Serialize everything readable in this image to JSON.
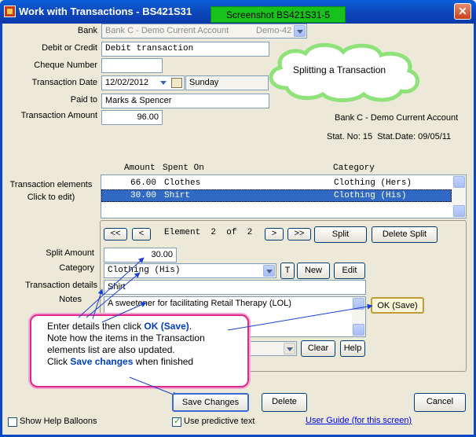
{
  "window": {
    "title": "Work with Transactions - BS421S31",
    "close_glyph": "✕"
  },
  "banner": "Screenshot BS421S31-5",
  "cloud_note": "Splitting a Transaction",
  "form": {
    "bank_label": "Bank",
    "bank_value": "Bank C - Demo Current Account",
    "bank_code": "Demo-42",
    "debit_label": "Debit or Credit",
    "debit_value": "Debit transaction",
    "cheque_label": "Cheque Number",
    "cheque_value": "",
    "date_label": "Transaction Date",
    "date_value": "12/02/2012",
    "day_value": "Sunday",
    "paid_label": "Paid to",
    "paid_value": "Marks & Spencer",
    "amount_label": "Transaction Amount",
    "amount_value": "96.00"
  },
  "account_info": {
    "name": "Bank C - Demo Current Account",
    "stat": "Stat. No: 15  Stat.Date: 09/05/11"
  },
  "elements": {
    "label_line1": "Transaction elements",
    "label_line2": "Click to edit)",
    "header_amount": "Amount",
    "header_spent": "Spent On",
    "header_category": "Category",
    "rows": [
      {
        "amount": "66.00",
        "spent_on": "Clothes",
        "category": "Clothing (Hers)",
        "selected": false
      },
      {
        "amount": "30.00",
        "spent_on": "Shirt",
        "category": "Clothing (His)",
        "selected": true
      }
    ]
  },
  "nav": {
    "first": "<<",
    "prev": "<",
    "counter": "Element  2  of  2",
    "next": ">",
    "last": ">>",
    "split": "Split",
    "delete_split": "Delete Split"
  },
  "split": {
    "amount_label": "Split Amount",
    "amount_value": "30.00",
    "category_label": "Category",
    "category_value": "Clothing (His)",
    "t_button": "T",
    "new_button": "New",
    "edit_button": "Edit",
    "details_label": "Transaction details",
    "details_value": "Shirt",
    "notes_label": "Notes",
    "notes_value": "A sweetener for facilitating Retail Therapy (LOL)",
    "ok_button": "OK (Save)",
    "clear_button": "Clear",
    "help_button": "Help"
  },
  "callout": {
    "line1_pre": "Enter details then click ",
    "line1_bold": "OK (Save)",
    "line1_post": ".",
    "line2": "Note how the items in the Transaction",
    "line3": "elements list are also updated.",
    "line4_pre": "Click ",
    "line4_bold": "Save changes",
    "line4_post": " when finished"
  },
  "buttons": {
    "save": "Save Changes",
    "delete": "Delete",
    "cancel": "Cancel"
  },
  "footer": {
    "help_balloons": "Show Help Balloons",
    "help_balloons_checked": false,
    "predictive": "Use predictive text",
    "predictive_checked": true,
    "guide": "User Guide (for this screen)"
  },
  "colors": {
    "titlebar": "#0a49c4",
    "banner": "#17c21a",
    "selection": "#316ac5",
    "callout_border": "#e0288c",
    "arrow": "#1c3fd4"
  }
}
